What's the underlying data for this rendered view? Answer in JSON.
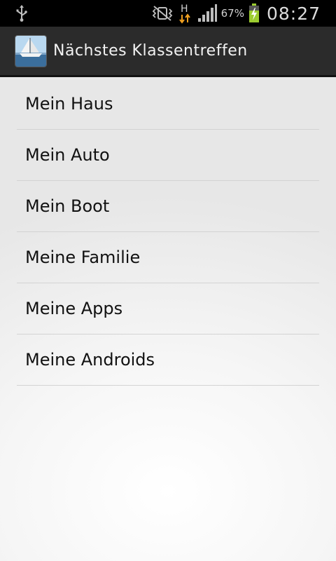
{
  "status_bar": {
    "icons": [
      "usb-icon",
      "vibrate-silent-icon",
      "network-h-icon",
      "signal-icon",
      "battery-charging-icon"
    ],
    "network_label": "H",
    "battery_percent": "67%",
    "time": "08:27"
  },
  "action_bar": {
    "app_icon": "sailboat-icon",
    "title": "Nächstes Klassentreffen"
  },
  "list": {
    "items": [
      {
        "label": "Mein Haus"
      },
      {
        "label": "Mein Auto"
      },
      {
        "label": "Mein Boot"
      },
      {
        "label": "Meine Familie"
      },
      {
        "label": "Meine Apps"
      },
      {
        "label": "Meine Androids"
      }
    ]
  }
}
